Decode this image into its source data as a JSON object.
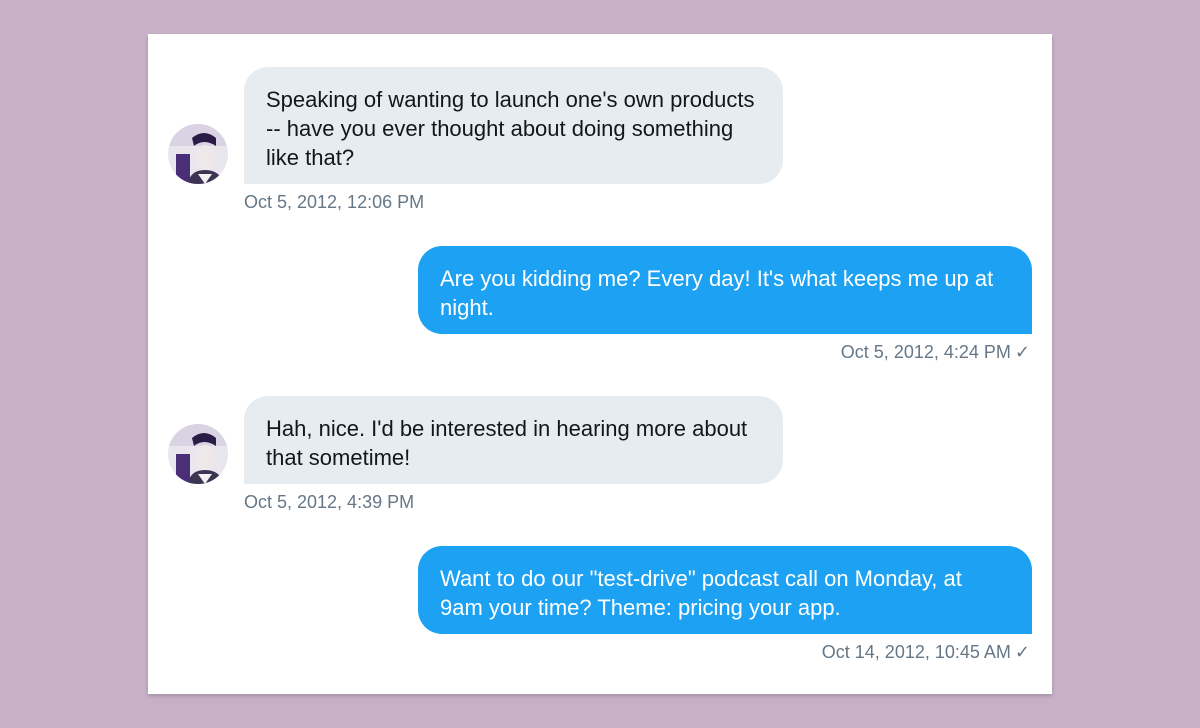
{
  "conversation": {
    "messages": [
      {
        "direction": "incoming",
        "text": "Speaking of wanting to launch one's own products -- have you ever thought about doing something like that?",
        "timestamp": "Oct 5, 2012, 12:06 PM",
        "avatar_icon": "user-avatar-icon"
      },
      {
        "direction": "outgoing",
        "text": "Are you kidding me? Every day! It's what keeps me up at night.",
        "timestamp": "Oct 5, 2012, 4:24 PM",
        "status_icon": "checkmark-icon",
        "status_glyph": "✓"
      },
      {
        "direction": "incoming",
        "text": "Hah, nice. I'd be interested in hearing more about that sometime!",
        "timestamp": "Oct 5, 2012, 4:39 PM",
        "avatar_icon": "user-avatar-icon"
      },
      {
        "direction": "outgoing",
        "text": "Want to do our \"test-drive\" podcast call on Monday, at 9am your time? Theme: pricing your app.",
        "timestamp": "Oct 14, 2012, 10:45 AM",
        "status_icon": "checkmark-icon",
        "status_glyph": "✓"
      }
    ]
  },
  "colors": {
    "page_background": "#c8b1c7",
    "card_background": "#ffffff",
    "incoming_bubble": "#e6ecf0",
    "outgoing_bubble": "#1da1f2",
    "timestamp_text": "#657786"
  }
}
